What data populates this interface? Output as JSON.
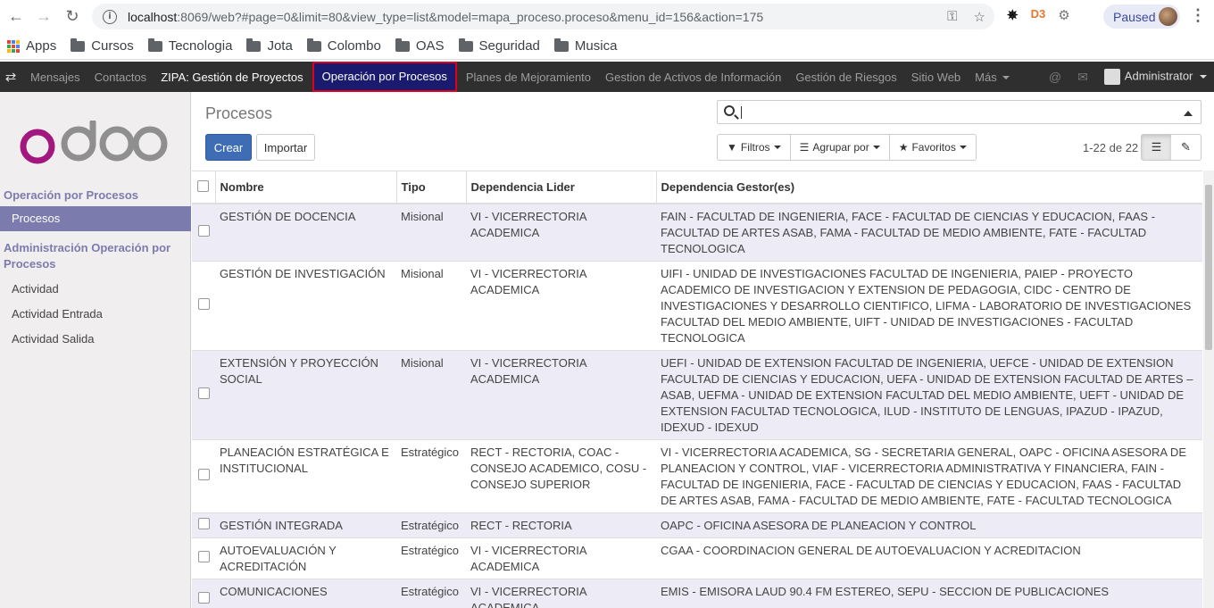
{
  "browser": {
    "url_host": "localhost",
    "url_rest": ":8069/web?#page=0&limit=80&view_type=list&model=mapa_proceso.proceso&menu_id=156&action=175",
    "profile_status": "Paused"
  },
  "bookmarks": [
    "Apps",
    "Cursos",
    "Tecnologia",
    "Jota",
    "Colombo",
    "OAS",
    "Seguridad",
    "Musica"
  ],
  "topmenu": {
    "items": [
      "Mensajes",
      "Contactos",
      "ZIPA: Gestión de Proyectos",
      "Operación por Procesos",
      "Planes de Mejoramiento",
      "Gestion de Activos de Información",
      "Gestión de Riesgos",
      "Sitio Web",
      "Más"
    ],
    "user": "Administrator"
  },
  "sidebar": {
    "section1": "Operación por Procesos",
    "item_active": "Procesos",
    "section2": "Administración Operación por Procesos",
    "items": [
      "Actividad",
      "Actividad Entrada",
      "Actividad Salida"
    ]
  },
  "control": {
    "title": "Procesos",
    "create": "Crear",
    "import": "Importar",
    "filters": "Filtros",
    "groupby": "Agrupar por",
    "favorites": "Favoritos",
    "pager": "1-22 de 22"
  },
  "table": {
    "headers": [
      "Nombre",
      "Tipo",
      "Dependencia Lider",
      "Dependencia Gestor(es)"
    ],
    "rows": [
      [
        "GESTIÓN DE DOCENCIA",
        "Misional",
        "VI - VICERRECTORIA ACADEMICA",
        "FAIN - FACULTAD DE INGENIERIA, FACE - FACULTAD DE CIENCIAS Y EDUCACION, FAAS - FACULTAD DE ARTES ASAB, FAMA - FACULTAD DE MEDIO AMBIENTE, FATE - FACULTAD TECNOLOGICA"
      ],
      [
        "GESTIÓN DE INVESTIGACIÓN",
        "Misional",
        "VI - VICERRECTORIA ACADEMICA",
        "UIFI - UNIDAD DE INVESTIGACIONES FACULTAD DE INGENIERIA, PAIEP - PROYECTO ACADEMICO DE INVESTIGACION Y EXTENSION DE PEDAGOGIA, CIDC - CENTRO DE INVESTIGACIONES Y DESARROLLO CIENTIFICO, LIFMA - LABORATORIO DE INVESTIGACIONES FACULTAD DEL MEDIO AMBIENTE, UIFT - UNIDAD DE INVESTIGACIONES - FACULTAD TECNOLOGICA"
      ],
      [
        "EXTENSIÓN Y PROYECCIÓN SOCIAL",
        "Misional",
        "VI - VICERRECTORIA ACADEMICA",
        "UEFI - UNIDAD DE EXTENSION FACULTAD DE INGENIERIA, UEFCE - UNIDAD DE EXTENSION FACULTAD DE CIENCIAS Y EDUCACION, UEFA - UNIDAD DE EXTENSION FACULTAD DE ARTES – ASAB, UEFMA - UNIDAD DE EXTENSION FACULTAD DEL MEDIO AMBIENTE, UEFT - UNIDAD DE EXTENSION FACULTAD TECNOLOGICA, ILUD - INSTITUTO DE LENGUAS, IPAZUD - IPAZUD, IDEXUD - IDEXUD"
      ],
      [
        "PLANEACIÓN ESTRATÉGICA E INSTITUCIONAL",
        "Estratégico",
        "RECT - RECTORIA, COAC - CONSEJO ACADEMICO, COSU - CONSEJO SUPERIOR",
        "VI - VICERRECTORIA ACADEMICA, SG - SECRETARIA GENERAL, OAPC - OFICINA ASESORA DE PLANEACION Y CONTROL, VIAF - VICERRECTORIA ADMINISTRATIVA Y FINANCIERA, FAIN - FACULTAD DE INGENIERIA, FACE - FACULTAD DE CIENCIAS Y EDUCACION, FAAS - FACULTAD DE ARTES ASAB, FAMA - FACULTAD DE MEDIO AMBIENTE, FATE - FACULTAD TECNOLOGICA"
      ],
      [
        "GESTIÓN INTEGRADA",
        "Estratégico",
        "RECT - RECTORIA",
        "OAPC - OFICINA ASESORA DE PLANEACION Y CONTROL"
      ],
      [
        "AUTOEVALUACIÓN Y ACREDITACIÓN",
        "Estratégico",
        "VI - VICERRECTORIA ACADEMICA",
        "CGAA - COORDINACION GENERAL DE AUTOEVALUACION Y ACREDITACION"
      ],
      [
        "COMUNICACIONES",
        "Estratégico",
        "VI - VICERRECTORIA ACADEMICA",
        "EMIS - EMISORA LAUD 90.4 FM ESTEREO, SEPU - SECCION DE PUBLICACIONES"
      ]
    ]
  }
}
